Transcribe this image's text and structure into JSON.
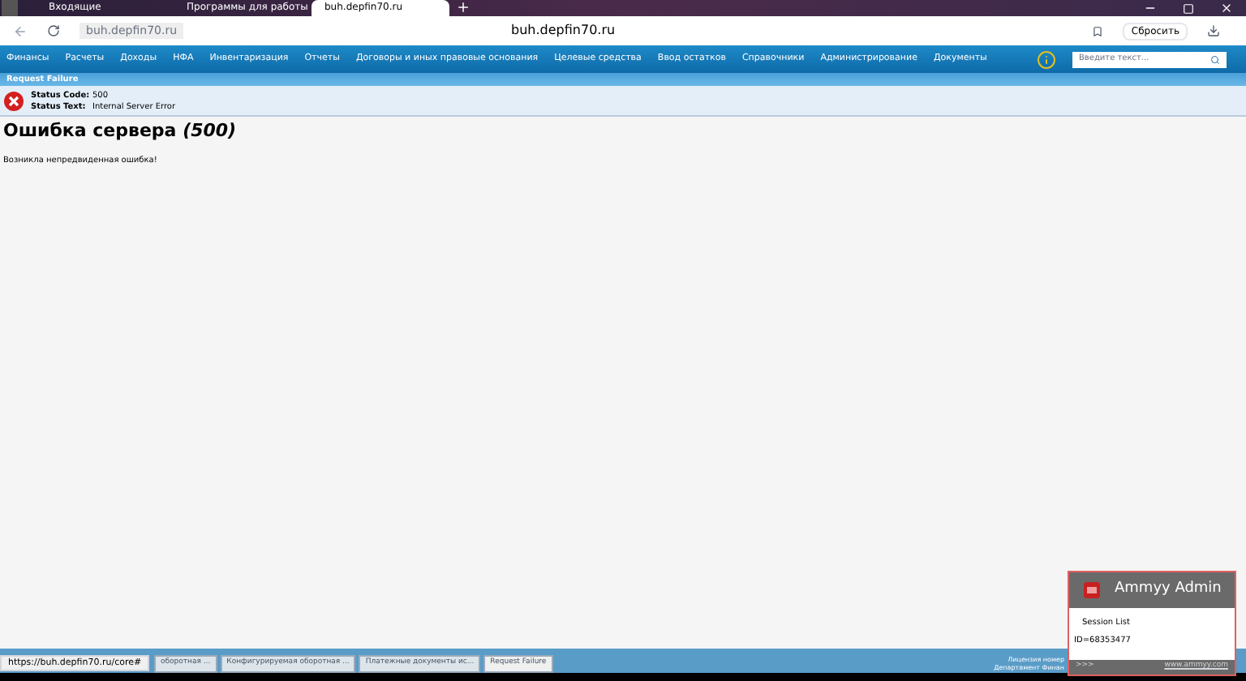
{
  "browser": {
    "tabs": [
      {
        "title": "Входящие",
        "selected": false
      },
      {
        "title": "Программы для работы",
        "selected": false
      },
      {
        "title": "buh.depfin70.ru",
        "selected": true
      }
    ],
    "address": "buh.depfin70.ru",
    "page_title": "buh.depfin70.ru",
    "reset_button": "Сбросить"
  },
  "nav": {
    "items": [
      "Финансы",
      "Расчеты",
      "Доходы",
      "НФА",
      "Инвентаризация",
      "Отчеты",
      "Договоры и иных правовые основания",
      "Целевые средства",
      "Ввод остатков",
      "Справочники",
      "Администрирование",
      "Документы"
    ],
    "search_placeholder": "Введите текст..."
  },
  "error_panel": {
    "title": "Request Failure",
    "code_label": "Status Code:",
    "code": "500",
    "text_label": "Status Text:",
    "text": "Internal Server Error"
  },
  "content": {
    "heading": "Ошибка сервера",
    "heading_code": "(500)",
    "message": "Возникла непредвиденная ошибка!"
  },
  "taskbar": {
    "tabs": [
      {
        "title": "оборотная ...",
        "selected": false
      },
      {
        "title": "Конфигурируемая оборотная ...",
        "selected": false
      },
      {
        "title": "Платежные документы ис...",
        "selected": false
      },
      {
        "title": "Request Failure",
        "selected": true
      }
    ],
    "footer_lines": [
      "Лицензия номер",
      "Департамент Финан"
    ]
  },
  "status_url": "https://buh.depfin70.ru/core#",
  "popup": {
    "title": "Ammyy Admin",
    "items": [
      "Session List",
      "ID=68353477"
    ],
    "more": ">>>",
    "link": "www.ammyy.com"
  }
}
